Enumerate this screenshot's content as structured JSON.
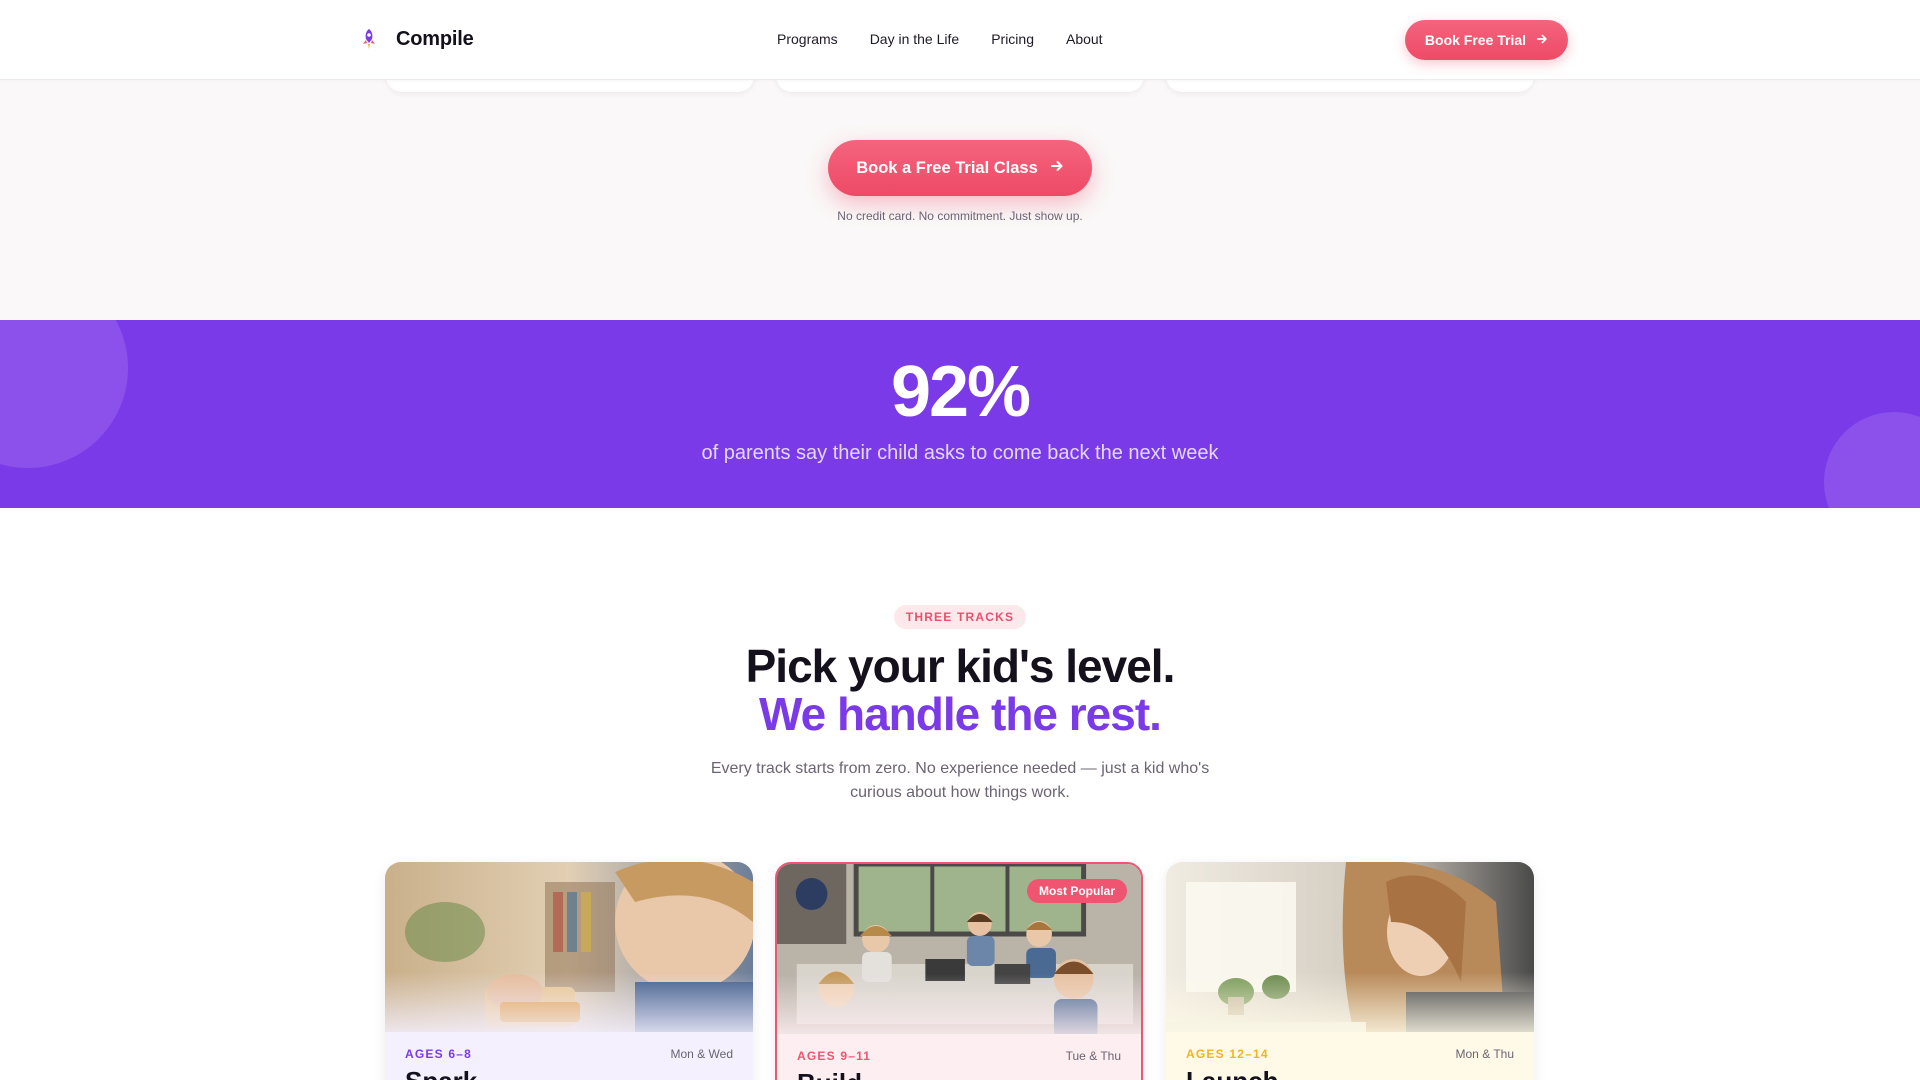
{
  "nav": {
    "brand": "Compile",
    "links": [
      "Programs",
      "Day in the Life",
      "Pricing",
      "About"
    ],
    "cta_label": "Book Free Trial"
  },
  "hero_cta": {
    "label": "Book a Free Trial Class",
    "note": "No credit card. No commitment. Just show up."
  },
  "stat": {
    "value": "92%",
    "caption": "of parents say their child asks to come back the next week"
  },
  "tracks_section": {
    "eyebrow": "THREE TRACKS",
    "headline_line1": "Pick your kid's level.",
    "headline_line2": "We handle the rest.",
    "subtext": "Every track starts from zero. No experience needed — just a kid who's curious about how things work.",
    "cards": [
      {
        "ages": "AGES 6–8",
        "days": "Mon & Wed",
        "name": "Spark",
        "accent": "#7b3ae8"
      },
      {
        "ages": "AGES 9–11",
        "days": "Tue & Thu",
        "name": "Build",
        "accent": "#ef5570",
        "badge": "Most Popular"
      },
      {
        "ages": "AGES 12–14",
        "days": "Mon & Thu",
        "name": "Launch",
        "accent": "#f2b51d"
      }
    ]
  },
  "colors": {
    "primary": "#7b3ae8",
    "accent": "#ef5570",
    "yellow": "#f2b51d"
  }
}
